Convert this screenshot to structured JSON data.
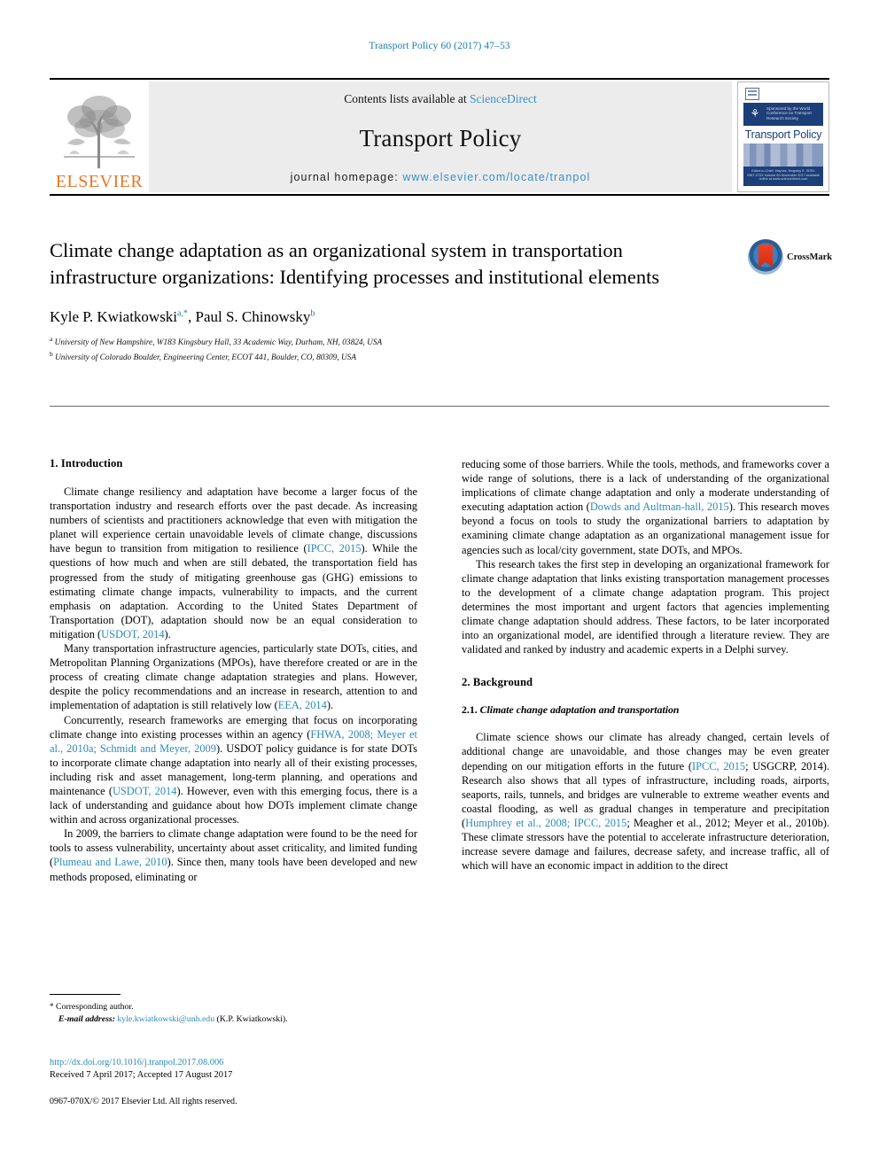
{
  "running_head": "Transport Policy 60 (2017) 47–53",
  "masthead": {
    "publisher_logo_label": "ELSEVIER",
    "contents_prefix": "Contents lists available at",
    "contents_link": "ScienceDirect",
    "journal_name": "Transport Policy",
    "homepage_prefix": "journal homepage:",
    "homepage_url": "www.elsevier.com/locate/tranpol",
    "cover": {
      "band_text": "Sponsored by the World Conference on Transport Research Society",
      "title": "Transport Policy",
      "footer_text": "Editor-in-Chief: Haynes, Kingsley E. ISSN: 0967-070X  Volume 60 November 2017 Available online at www.sciencedirect.com"
    }
  },
  "article": {
    "title": "Climate change adaptation as an organizational system in transportation infrastructure organizations: Identifying processes and institutional elements",
    "crossmark_label": "CrossMark",
    "authors": [
      {
        "name": "Kyle P. Kwiatkowski",
        "marks": "a,",
        "star": "*"
      },
      {
        "name": "Paul S. Chinowsky",
        "marks": "b",
        "star": ""
      }
    ],
    "authors_separator": ", ",
    "affiliations": [
      {
        "mark": "a",
        "text": "University of New Hampshire, W183 Kingsbury Hall, 33 Academic Way, Durham, NH, 03824, USA"
      },
      {
        "mark": "b",
        "text": "University of Colorado Boulder, Engineering Center, ECOT 441, Boulder, CO, 80309, USA"
      }
    ]
  },
  "sections": {
    "introduction_heading": "1.  Introduction",
    "background_heading": "2.  Background",
    "background_sub_num": "2.1.  ",
    "background_sub_title": "Climate change adaptation and transportation"
  },
  "body": {
    "left": [
      "Climate change resiliency and adaptation have become a larger focus of the transportation industry and research efforts over the past decade. As increasing numbers of scientists and practitioners acknowledge that even with mitigation the planet will experience certain unavoidable levels of climate change, discussions have begun to transition from mitigation to resilience (IPCC, 2015). While the questions of how much and when are still debated, the transportation field has progressed from the study of mitigating greenhouse gas (GHG) emissions to estimating climate change impacts, vulnerability to impacts, and the current emphasis on adaptation. According to the United States Department of Transportation (DOT), adaptation should now be an equal consideration to mitigation (USDOT, 2014).",
      "Many transportation infrastructure agencies, particularly state DOTs, cities, and Metropolitan Planning Organizations (MPOs), have therefore created or are in the process of creating climate change adaptation strategies and plans. However, despite the policy recommendations and an increase in research, attention to and implementation of adaptation is still relatively low (EEA, 2014).",
      "Concurrently, research frameworks are emerging that focus on incorporating climate change into existing processes within an agency (FHWA, 2008; Meyer et al., 2010a; Schmidt and Meyer, 2009). USDOT policy guidance is for state DOTs to incorporate climate change adaptation into nearly all of their existing processes, including risk and asset management, long-term planning, and operations and maintenance (USDOT, 2014). However, even with this emerging focus, there is a lack of understanding and guidance about how DOTs implement climate change within and across organizational processes.",
      "In 2009, the barriers to climate change adaptation were found to be the need for tools to assess vulnerability, uncertainty about asset criticality, and limited funding (Plumeau and Lawe, 2010). Since then, many tools have been developed and new methods proposed, eliminating or"
    ],
    "right": [
      "reducing some of those barriers. While the tools, methods, and frameworks cover a wide range of solutions, there is a lack of understanding of the organizational implications of climate change adaptation and only a moderate understanding of executing adaptation action (Dowds and Aultman-hall, 2015). This research moves beyond a focus on tools to study the organizational barriers to adaptation by examining climate change adaptation as an organizational management issue for agencies such as local/city government, state DOTs, and MPOs.",
      "This research takes the first step in developing an organizational framework for climate change adaptation that links existing transportation management processes to the development of a climate change adaptation program. This project determines the most important and urgent factors that agencies implementing climate change adaptation should address. These factors, to be later incorporated into an organizational model, are identified through a literature review. They are validated and ranked by industry and academic experts in a Delphi survey.",
      "Climate science shows our climate has already changed, certain levels of additional change are unavoidable, and those changes may be even greater depending on our mitigation efforts in the future (IPCC, 2015; USGCRP, 2014). Research also shows that all types of infrastructure, including roads, airports, seaports, rails, tunnels, and bridges are vulnerable to extreme weather events and coastal flooding, as well as gradual changes in temperature and precipitation (Humphrey et al., 2008; IPCC, 2015; Meagher et al., 2012; Meyer et al., 2010b). These climate stressors have the potential to accelerate infrastructure deterioration, increase severe damage and failures, decrease safety, and increase traffic, all of which will have an economic impact in addition to the direct"
    ]
  },
  "footer": {
    "corresponding_star": "*",
    "corresponding_label": "Corresponding author.",
    "email_label": "E-mail address:",
    "email": "kyle.kwiatkowski@unh.edu",
    "email_owner": "(K.P. Kwiatkowski).",
    "doi": "http://dx.doi.org/10.1016/j.tranpol.2017.08.006",
    "dates": "Received 7 April 2017; Accepted 17 August 2017",
    "copyright": "0967-070X/© 2017 Elsevier Ltd. All rights reserved."
  },
  "colors": {
    "link": "#2a8ab8",
    "running_head": "#1a7db6",
    "elsevier_orange": "#E87722",
    "cover_blue": "#1d3f78",
    "crossmark_red": "#ef4323"
  }
}
